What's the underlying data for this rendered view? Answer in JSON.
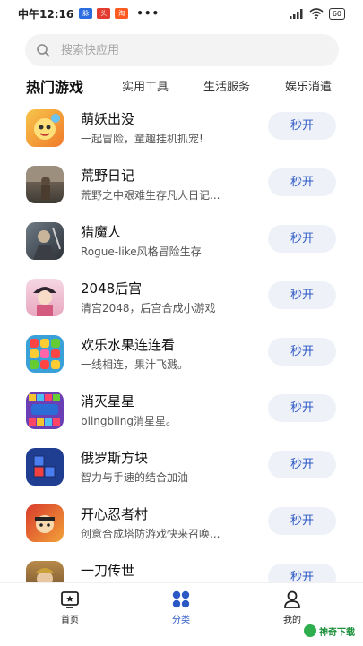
{
  "status_bar": {
    "time": "中午12:16",
    "notif_badges": [
      "脉",
      "头",
      "淘"
    ],
    "dots": "•••",
    "battery": "60"
  },
  "search": {
    "placeholder": "搜索快应用"
  },
  "tabs": [
    {
      "label": "热门游戏",
      "active": true
    },
    {
      "label": "实用工具",
      "active": false
    },
    {
      "label": "生活服务",
      "active": false
    },
    {
      "label": "娱乐消遣",
      "active": false
    }
  ],
  "apps": [
    {
      "name": "萌妖出没",
      "desc": "一起冒险，童趣挂机抓宠!",
      "action": "秒开"
    },
    {
      "name": "荒野日记",
      "desc": "荒野之中艰难生存凡人日记...",
      "action": "秒开"
    },
    {
      "name": "猎魔人",
      "desc": "Rogue-like风格冒险生存",
      "action": "秒开"
    },
    {
      "name": "2048后宫",
      "desc": "清宫2048，后宫合成小游戏",
      "action": "秒开"
    },
    {
      "name": "欢乐水果连连看",
      "desc": "一线相连，果汁飞溅。",
      "action": "秒开"
    },
    {
      "name": "消灭星星",
      "desc": "blingbling消星星。",
      "action": "秒开"
    },
    {
      "name": "俄罗斯方块",
      "desc": "智力与手速的结合加油",
      "action": "秒开"
    },
    {
      "name": "开心忍者村",
      "desc": "创意合成塔防游戏快来召唤...",
      "action": "秒开"
    },
    {
      "name": "一刀传世",
      "desc": "",
      "action": "秒开"
    }
  ],
  "bottom_nav": [
    {
      "label": "首页",
      "icon": "home-star-icon",
      "active": false
    },
    {
      "label": "分类",
      "icon": "category-grid-icon",
      "active": true
    },
    {
      "label": "我的",
      "icon": "user-icon",
      "active": false
    }
  ],
  "watermark": "神奇下载",
  "colors": {
    "accent": "#2b58c5",
    "button_bg": "#eef1f8",
    "search_bg": "#f3f3f3"
  }
}
